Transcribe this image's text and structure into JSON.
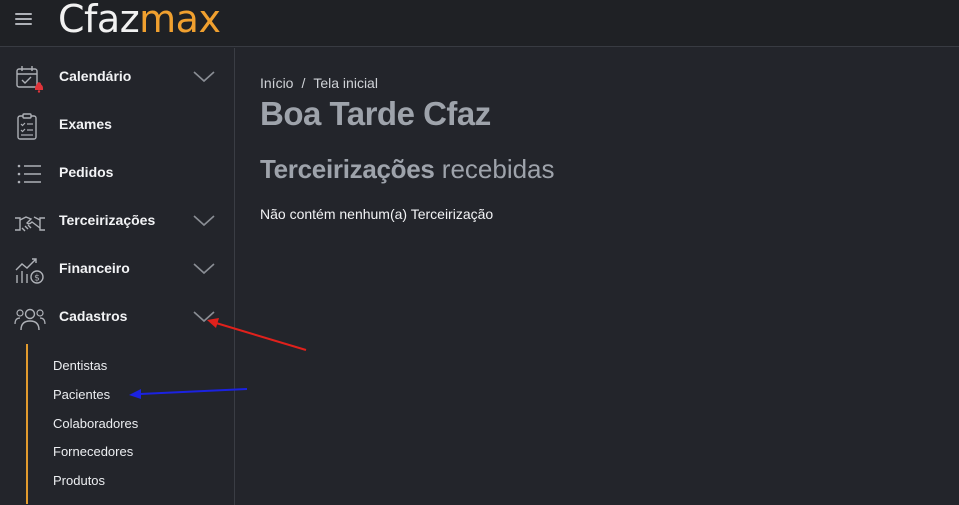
{
  "header": {
    "logo_part1": "Cfaz",
    "logo_part2": "max",
    "menu_icon": "hamburger-icon"
  },
  "sidebar": {
    "items": [
      {
        "label": "Calendário",
        "icon": "calendar-icon",
        "expandable": true
      },
      {
        "label": "Exames",
        "icon": "clipboard-icon",
        "expandable": false
      },
      {
        "label": "Pedidos",
        "icon": "list-icon",
        "expandable": false
      },
      {
        "label": "Terceirizações",
        "icon": "handshake-icon",
        "expandable": true
      },
      {
        "label": "Financeiro",
        "icon": "finance-icon",
        "expandable": true
      },
      {
        "label": "Cadastros",
        "icon": "users-icon",
        "expandable": true,
        "expanded": true
      }
    ],
    "submenu": [
      "Dentistas",
      "Pacientes",
      "Colaboradores",
      "Fornecedores",
      "Produtos"
    ]
  },
  "main": {
    "breadcrumb": {
      "home": "Início",
      "separator": "/",
      "current": "Tela inicial"
    },
    "greeting": "Boa Tarde Cfaz",
    "section_title_bold": "Terceirizações",
    "section_title_light": "recebidas",
    "empty_message": "Não contém nenhum(a) Terceirização"
  },
  "colors": {
    "background": "#23252b",
    "accent": "#f0a02f",
    "notification_dot": "#e0343a",
    "annotation_red": "#e0211c",
    "annotation_blue": "#1b22e0"
  }
}
